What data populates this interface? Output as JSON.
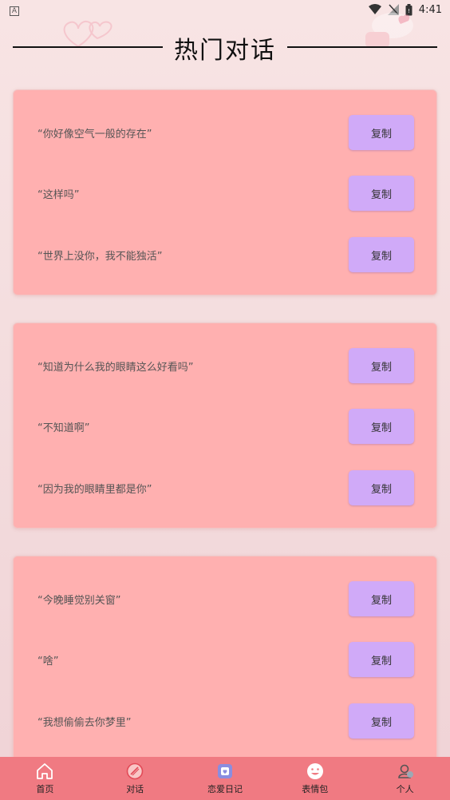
{
  "status_bar": {
    "left_icon": "A",
    "time": "4:41"
  },
  "header": {
    "title": "热门对话"
  },
  "cards": [
    {
      "rows": [
        {
          "text": "“你好像空气一般的存在”",
          "button": "复制"
        },
        {
          "text": "“这样吗”",
          "button": "复制"
        },
        {
          "text": "“世界上没你，我不能独活”",
          "button": "复制"
        }
      ]
    },
    {
      "rows": [
        {
          "text": "“知道为什么我的眼睛这么好看吗”",
          "button": "复制"
        },
        {
          "text": "“不知道啊”",
          "button": "复制"
        },
        {
          "text": "“因为我的眼睛里都是你”",
          "button": "复制"
        }
      ]
    },
    {
      "rows": [
        {
          "text": "“今晚睡觉别关窗”",
          "button": "复制"
        },
        {
          "text": "“啥”",
          "button": "复制"
        },
        {
          "text": "“我想偷偷去你梦里”",
          "button": "复制"
        }
      ]
    }
  ],
  "tabbar": {
    "items": [
      {
        "label": "首页",
        "icon": "home-icon"
      },
      {
        "label": "对话",
        "icon": "chat-bubble-icon"
      },
      {
        "label": "恋爱日记",
        "icon": "diary-icon"
      },
      {
        "label": "表情包",
        "icon": "smiley-icon"
      },
      {
        "label": "个人",
        "icon": "person-icon"
      }
    ]
  },
  "colors": {
    "card": "#ffb0b0",
    "button": "#d0aaf8",
    "tabbar": "#f07a82"
  }
}
